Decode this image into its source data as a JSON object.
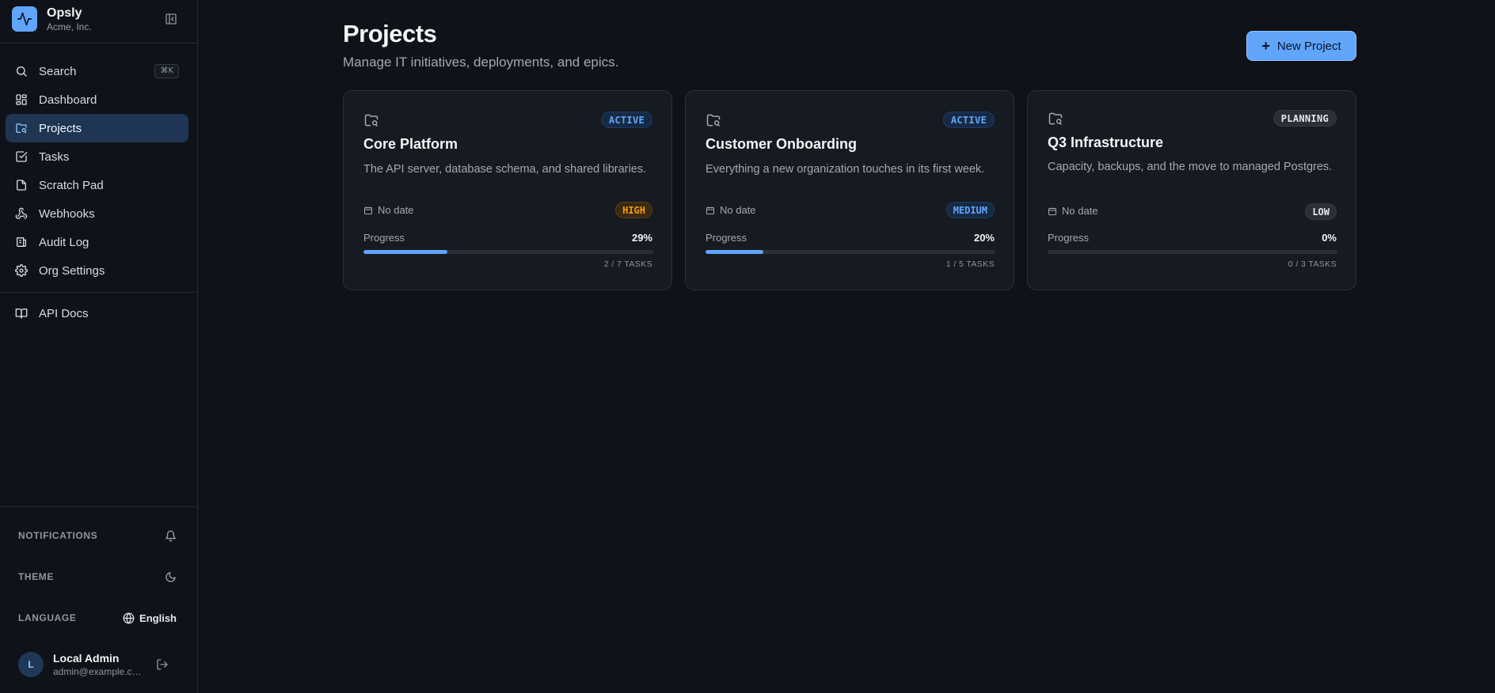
{
  "brand": {
    "name": "Opsly",
    "org": "Acme, Inc."
  },
  "nav": {
    "search": {
      "label": "Search",
      "shortcut": "⌘K"
    },
    "items": [
      {
        "label": "Dashboard",
        "icon": "grid-icon"
      },
      {
        "label": "Projects",
        "icon": "folder-icon",
        "active": true
      },
      {
        "label": "Tasks",
        "icon": "checkbox-icon"
      },
      {
        "label": "Scratch Pad",
        "icon": "file-icon"
      },
      {
        "label": "Webhooks",
        "icon": "webhook-icon"
      },
      {
        "label": "Audit Log",
        "icon": "log-icon"
      },
      {
        "label": "Org Settings",
        "icon": "gear-icon"
      }
    ],
    "secondary": [
      {
        "label": "API Docs",
        "icon": "book-icon"
      }
    ]
  },
  "settings": {
    "notifications_label": "NOTIFICATIONS",
    "theme_label": "THEME",
    "language_label": "LANGUAGE",
    "language_value": "English"
  },
  "user": {
    "initial": "L",
    "name": "Local Admin",
    "email": "admin@example.com"
  },
  "header": {
    "title": "Projects",
    "subtitle": "Manage IT initiatives, deployments, and epics.",
    "new_button": "New Project"
  },
  "progress_label": "Progress",
  "projects": [
    {
      "status": "ACTIVE",
      "title": "Core Platform",
      "description": "The API server, database schema, and shared libraries.",
      "date": "No date",
      "priority": "HIGH",
      "progress_text": "29%",
      "progress": 0.29,
      "tasks": "2 / 7 TASKS"
    },
    {
      "status": "ACTIVE",
      "title": "Customer Onboarding",
      "description": "Everything a new organization touches in its first week.",
      "date": "No date",
      "priority": "MEDIUM",
      "progress_text": "20%",
      "progress": 0.2,
      "tasks": "1 / 5 TASKS"
    },
    {
      "status": "PLANNING",
      "title": "Q3 Infrastructure",
      "description": "Capacity, backups, and the move to managed Postgres.",
      "date": "No date",
      "priority": "LOW",
      "progress_text": "0%",
      "progress": 0,
      "tasks": "0 / 3 TASKS"
    }
  ],
  "colors": {
    "accent": "#60a5fa",
    "background": "#0f1218",
    "card": "#161a21",
    "high": "#f59e0b"
  }
}
